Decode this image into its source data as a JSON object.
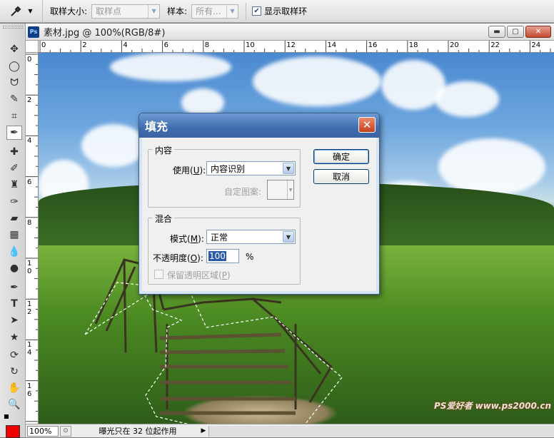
{
  "optbar": {
    "sample_size_label": "取样大小:",
    "sample_size_value": "取样点",
    "sample_label": "样本:",
    "sample_value": "所有...",
    "show_ring_label": "显示取样环",
    "show_ring_checked": true
  },
  "document": {
    "title": "素材.jpg @ 100%(RGB/8#)",
    "ps_badge": "Ps",
    "ruler_h_ticks": [
      "0",
      "2",
      "4",
      "6",
      "8",
      "10",
      "12",
      "14",
      "16",
      "18",
      "20",
      "22",
      "24"
    ],
    "ruler_v_ticks": [
      "0",
      "2",
      "4",
      "6",
      "8",
      "10",
      "12",
      "14",
      "16"
    ]
  },
  "statusbar": {
    "zoom": "100%",
    "message": "曝光只在 32 位起作用"
  },
  "watermark": "PS爱好者 www.ps2000.cn",
  "dialog": {
    "title": "填充",
    "content_group": "内容",
    "use_label": "使用",
    "use_key": "U",
    "use_value": "内容识别",
    "custom_pattern_label": "自定图案:",
    "blend_group": "混合",
    "mode_label": "模式",
    "mode_key": "M",
    "mode_value": "正常",
    "opacity_label": "不透明度",
    "opacity_key": "O",
    "opacity_value": "100",
    "opacity_unit": "%",
    "preserve_label": "保留透明区域",
    "preserve_key": "P",
    "ok_label": "确定",
    "cancel_label": "取消"
  },
  "colors": {
    "foreground": "#ee0000",
    "annotation_ring": "#e8343a"
  }
}
